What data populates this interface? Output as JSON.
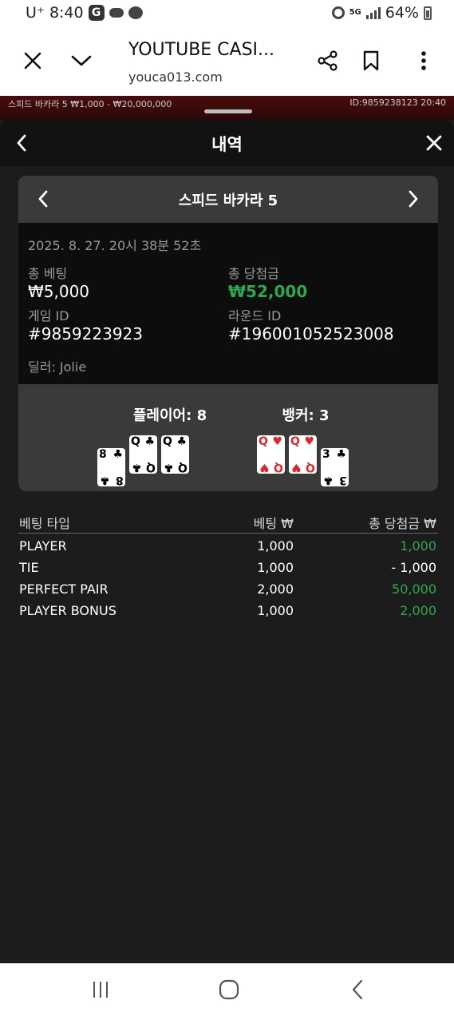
{
  "status_bar": {
    "carrier": "U⁺",
    "time": "8:40",
    "network": "5G",
    "battery": "64%"
  },
  "browser": {
    "title": "YOUTUBE CASI...",
    "url": "youca013.com"
  },
  "game_strip": {
    "table_info": "스피드 바카라 5  ₩1,000 - ₩20,000,000",
    "id_time": "ID:9859238123  20:40"
  },
  "sheet": {
    "title": "내역"
  },
  "card": {
    "game_name": "스피드 바카라 5",
    "datetime": "2025. 8. 27. 20시 38분 52초",
    "total_bet_label": "총 베팅",
    "total_bet_value": "₩5,000",
    "total_win_label": "총 당첨금",
    "total_win_value": "₩52,000",
    "game_id_label": "게임 ID",
    "game_id_value": "#9859223923",
    "round_id_label": "라운드 ID",
    "round_id_value": "#196001052523008",
    "dealer": "딜러: Jolie",
    "player_label": "플레이어: 8",
    "banker_label": "뱅커: 3",
    "player_cards": [
      {
        "rank": "8",
        "suit": "♣",
        "color": "black"
      },
      {
        "rank": "Q",
        "suit": "♣",
        "color": "black"
      },
      {
        "rank": "Q",
        "suit": "♣",
        "color": "black"
      }
    ],
    "banker_cards": [
      {
        "rank": "Q",
        "suit": "♥",
        "color": "red"
      },
      {
        "rank": "Q",
        "suit": "♥",
        "color": "red"
      },
      {
        "rank": "3",
        "suit": "♣",
        "color": "black"
      }
    ]
  },
  "bets": {
    "headers": {
      "type": "베팅 타입",
      "bet": "베팅 ₩",
      "win": "총 당첨금 ₩"
    },
    "rows": [
      {
        "type": "PLAYER",
        "bet": "1,000",
        "win": "1,000",
        "positive": true
      },
      {
        "type": "TIE",
        "bet": "1,000",
        "win": "- 1,000",
        "positive": false
      },
      {
        "type": "PERFECT PAIR",
        "bet": "2,000",
        "win": "50,000",
        "positive": true
      },
      {
        "type": "PLAYER BONUS",
        "bet": "1,000",
        "win": "2,000",
        "positive": true
      }
    ]
  },
  "colors": {
    "win_green": "#2ea84f",
    "red_suit": "#e0262b"
  }
}
